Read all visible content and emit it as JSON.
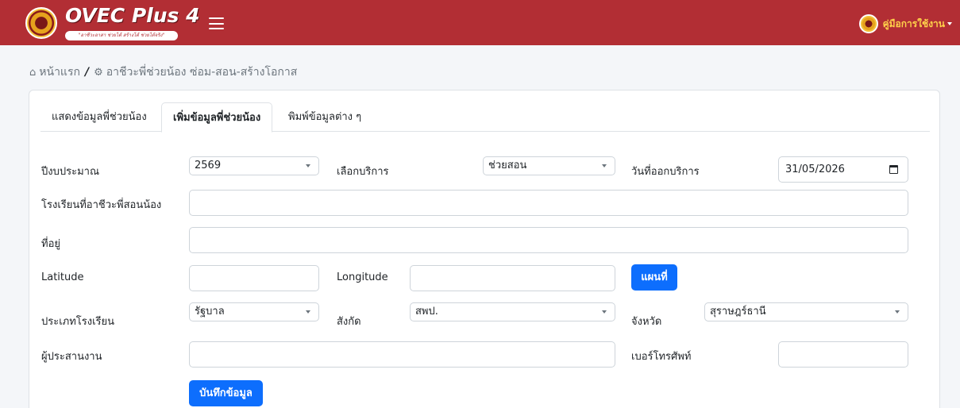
{
  "navbar": {
    "logo_text": "OVEC Plus 4",
    "logo_tagline": "\"อาชีวะอาสา ช่วยได้ สร้างได้ ช่วยได้จริง\"",
    "user_menu_label": "คู่มือการใช้งาน",
    "brand_color": "#b22e34",
    "icons": {
      "menu": "hamburger-icon",
      "user": "seal-avatar-icon",
      "dropdown": "caret-down-icon"
    }
  },
  "breadcrumb": {
    "home_label": "หน้าแรก",
    "separator": "/",
    "current_label": "อาชีวะพี่ช่วยน้อง ซ่อม-สอน-สร้างโอกาส",
    "icons": {
      "home": "home-icon",
      "current": "gear-icon"
    }
  },
  "tabs": [
    {
      "label": "แสดงข้อมูลพี่ช่วยน้อง",
      "active": false
    },
    {
      "label": "เพิ่มข้อมูลพี่ช่วยน้อง",
      "active": true
    },
    {
      "label": "พิมพ์ข้อมูลต่าง ๆ",
      "active": false
    }
  ],
  "form": {
    "fiscal_year": {
      "label": "ปีงบประมาณ",
      "value": "2569"
    },
    "service": {
      "label": "เลือกบริการ",
      "value": "ช่วยสอน"
    },
    "service_date": {
      "label": "วันที่ออกบริการ",
      "value": "31/05/2026"
    },
    "school": {
      "label": "โรงเรียนที่อาชีวะพี่สอนน้อง",
      "value": ""
    },
    "address": {
      "label": "ที่อยู่",
      "value": ""
    },
    "latitude": {
      "label": "Latitude",
      "value": ""
    },
    "longitude": {
      "label": "Longitude",
      "value": ""
    },
    "map_button": "แผนที่",
    "school_type": {
      "label": "ประเภทโรงเรียน",
      "value": "รัฐบาล"
    },
    "affiliation": {
      "label": "สังกัด",
      "value": "สพป."
    },
    "province": {
      "label": "จังหวัด",
      "value": "สุราษฎร์ธานี"
    },
    "coordinator": {
      "label": "ผู้ประสานงาน",
      "value": ""
    },
    "phone": {
      "label": "เบอร์โทรศัพท์",
      "value": ""
    },
    "save_button": "บันทึกข้อมูล",
    "button_color": "#0d6efd"
  }
}
